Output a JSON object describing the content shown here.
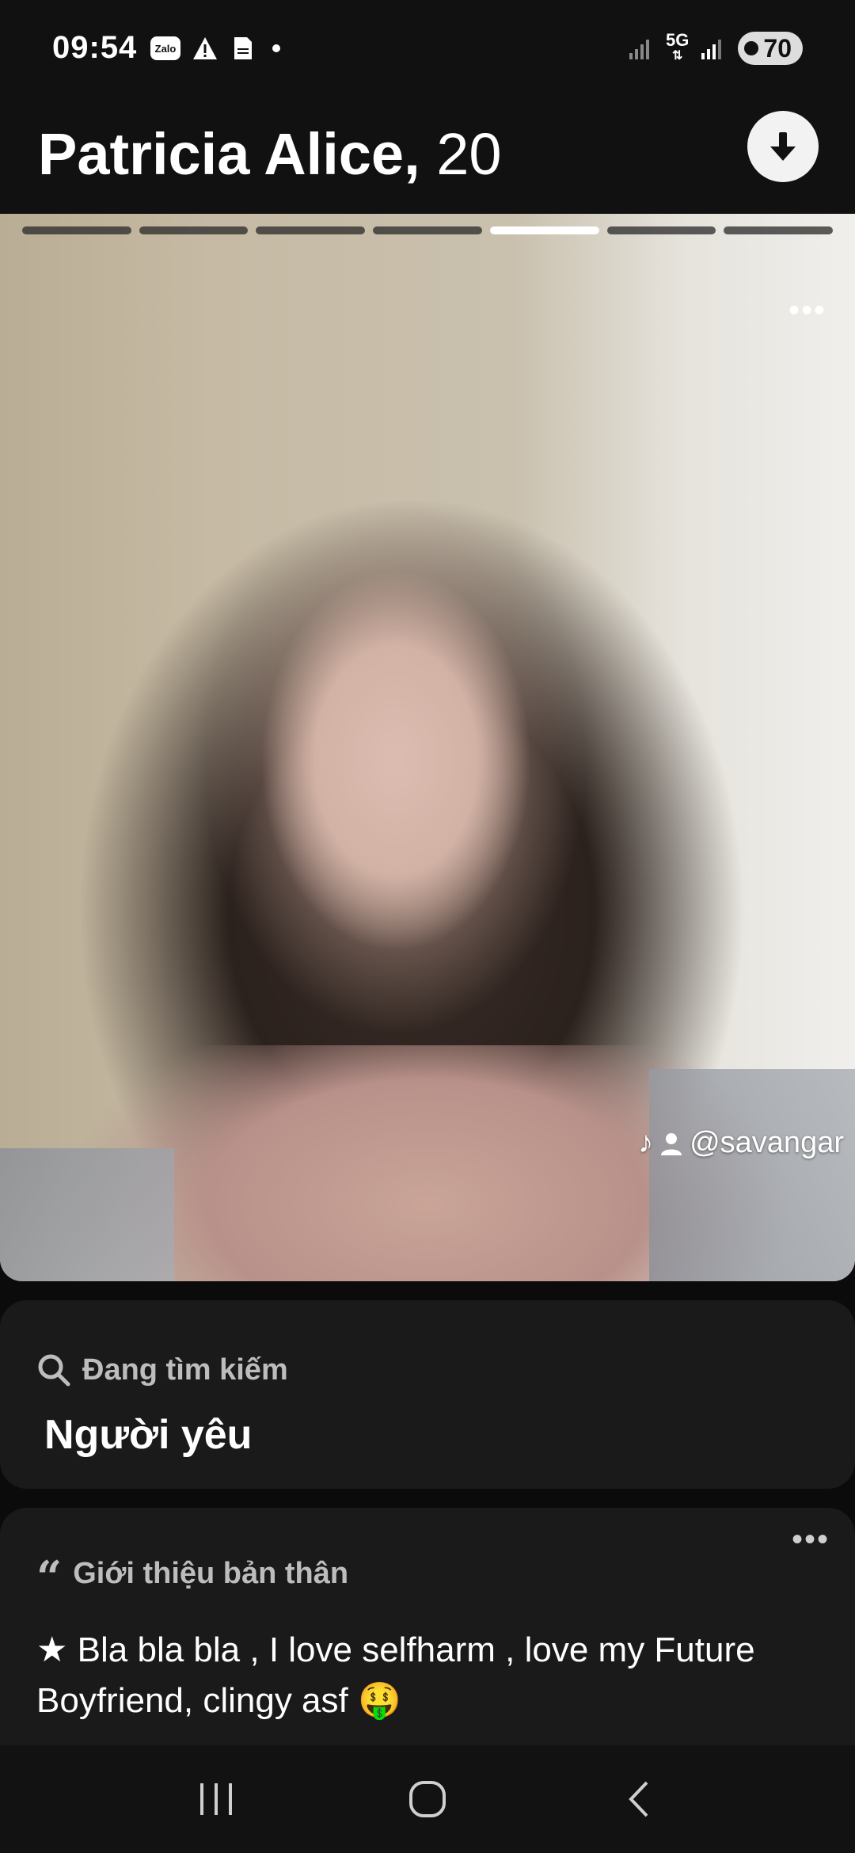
{
  "status_bar": {
    "time": "09:54",
    "left_icons": [
      "zalo-icon",
      "warning-icon",
      "pdf-icon",
      "dot-icon"
    ],
    "zalo_label": "Zalo",
    "network": "5G",
    "battery": "70"
  },
  "profile": {
    "name": "Patricia Alice,",
    "age": "20"
  },
  "photo": {
    "total_photos": 7,
    "current_photo_index": 5,
    "watermark": "@savangar",
    "menu": "•••"
  },
  "looking_for": {
    "label": "Đang tìm kiếm",
    "value": "Người yêu"
  },
  "about": {
    "label": "Giới thiệu bản thân",
    "menu": "•••",
    "text": "★ Bla bla bla , I love selfharm , love my Future Boyfriend, clingy asf 🤑"
  },
  "navbar": {
    "items": [
      "recent-apps-icon",
      "home-icon",
      "back-icon"
    ]
  },
  "colors": {
    "background": "#0b0b0b",
    "card": "#1a1a1a",
    "muted_text": "#bdbdbd"
  }
}
